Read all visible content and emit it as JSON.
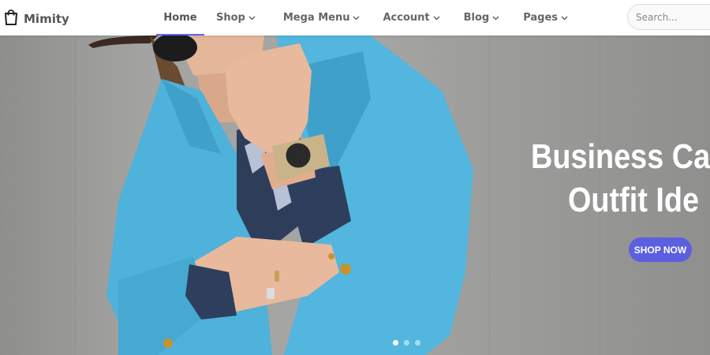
{
  "brand": {
    "name": "Mimity",
    "icon": "shopping-bag-icon"
  },
  "nav": {
    "items": [
      {
        "label": "Home",
        "active": true
      },
      {
        "label": "Shop",
        "dropdown": true
      },
      {
        "label": "Mega Menu",
        "dropdown": true
      },
      {
        "label": "Account",
        "dropdown": true
      },
      {
        "label": "Blog",
        "dropdown": true
      },
      {
        "label": "Pages",
        "dropdown": true
      }
    ]
  },
  "search": {
    "placeholder": "Search..."
  },
  "hero": {
    "headline_line1": "Business Ca",
    "headline_line2": "Outfit Ide",
    "button_label": "SHOP NOW",
    "slides": {
      "count": 3,
      "active": 1
    }
  },
  "colors": {
    "accent": "#6366f1",
    "button": "#5b5fe0",
    "jacket": "#4fb3d9"
  }
}
